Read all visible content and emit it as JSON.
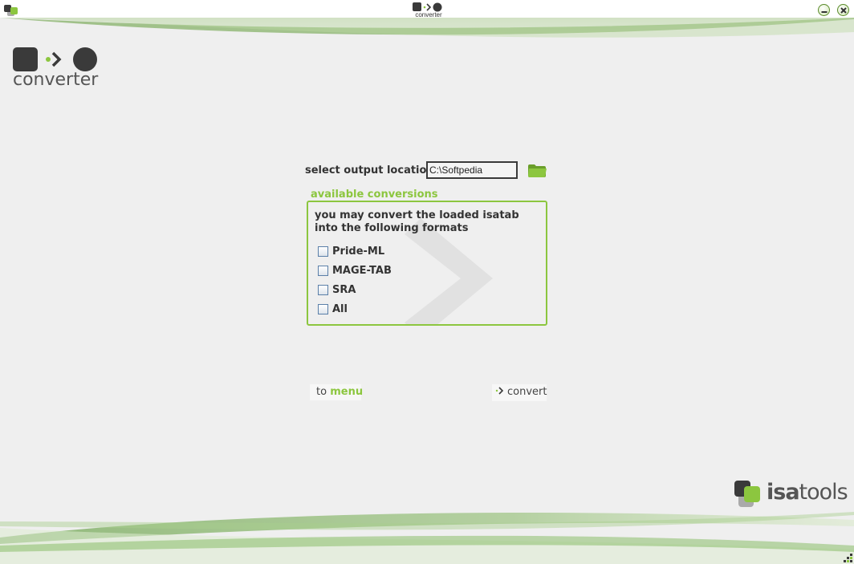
{
  "window": {
    "title_logo_text": "converter"
  },
  "header": {
    "logo_text": "converter"
  },
  "output": {
    "label": "select output location",
    "path_value": "C:\\Softpedia"
  },
  "conversions": {
    "title": "available conversions",
    "description": "you may convert the loaded isatab into the following formats",
    "options": [
      {
        "label": "Pride-ML",
        "checked": false
      },
      {
        "label": "MAGE-TAB",
        "checked": false
      },
      {
        "label": "SRA",
        "checked": false
      },
      {
        "label": "All",
        "checked": false
      }
    ]
  },
  "actions": {
    "to_menu_prefix": "to",
    "to_menu_label": "menu",
    "convert_label": "convert"
  },
  "branding": {
    "isatools_prefix": "isa",
    "isatools_suffix": "tools"
  },
  "colors": {
    "accent_green": "#8cc63f",
    "dark_square": "#3a3a3a",
    "text_dark": "#333333"
  },
  "icons": {
    "folder": "folder-icon",
    "convert": "chevron-right-icon",
    "minimize": "minimize-icon",
    "close": "close-icon"
  }
}
